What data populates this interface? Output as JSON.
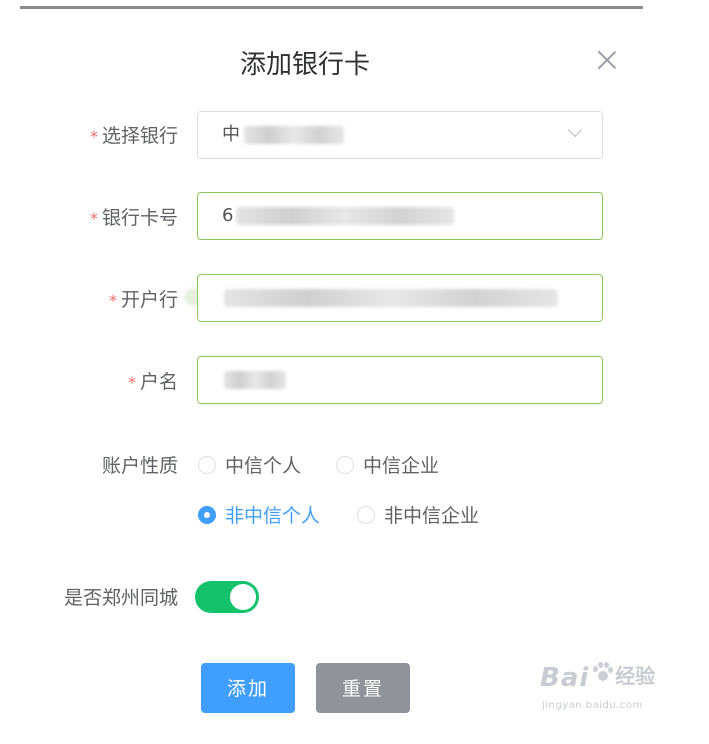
{
  "dialog": {
    "title": "添加银行卡",
    "close_icon": "close-icon"
  },
  "form": {
    "bank_select": {
      "required_mark": "*",
      "label": "选择银行",
      "value": "中",
      "icon": "chevron-down-icon"
    },
    "card_number": {
      "required_mark": "*",
      "label": "银行卡号",
      "value": "6"
    },
    "branch": {
      "required_mark": "*",
      "label": "开户行",
      "value": ""
    },
    "account_name": {
      "required_mark": "*",
      "label": "户名",
      "value": ""
    },
    "account_type": {
      "label": "账户性质",
      "options": [
        "中信个人",
        "中信企业",
        "非中信个人",
        "非中信企业"
      ],
      "selected": "非中信个人"
    },
    "same_city": {
      "label": "是否郑州同城",
      "on": true
    }
  },
  "buttons": {
    "add": "添加",
    "reset": "重置"
  },
  "watermark": {
    "brand": "Bai",
    "brand_tail": "经验",
    "site": "jingyan.baidu.com"
  },
  "colors": {
    "primary": "#409eff",
    "info": "#909399",
    "switch_on": "#13c26a",
    "required": "#f56c6c",
    "valid_border": "#8cc85a"
  }
}
